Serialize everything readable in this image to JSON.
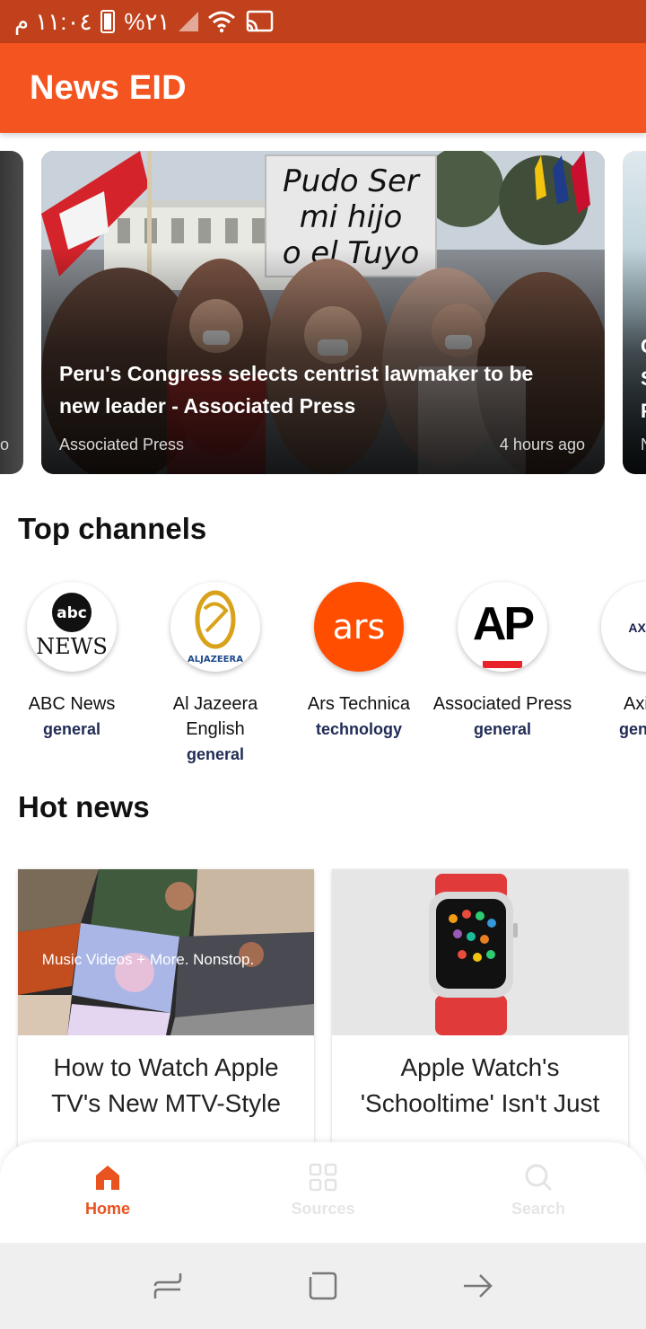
{
  "status_bar": {
    "time": "١١:٠٤ م",
    "battery": "%٢١",
    "color": "#c0411b"
  },
  "app_bar": {
    "title": "News EID",
    "color": "#f4541f"
  },
  "carousel": {
    "main": {
      "title": "Peru's Congress selects centrist lawmaker to be new leader - Associated Press",
      "source": "Associated Press",
      "time": "4 hours ago",
      "sign_text": "Pudo Ser mi hijo o el Tuyo"
    },
    "next_partial": {
      "lines": [
        "C",
        "S",
        "F"
      ],
      "source_partial": "N"
    },
    "prev_partial": {
      "source_partial": "o"
    }
  },
  "top_channels": {
    "title": "Top channels",
    "items": [
      {
        "name": "ABC News",
        "category": "general",
        "logo": "abc-news-logo"
      },
      {
        "name": "Al Jazeera English",
        "category": "general",
        "logo": "aljazeera-logo",
        "logo_text": "ALJAZEERA"
      },
      {
        "name": "Ars Technica",
        "category": "technology",
        "logo": "ars-logo",
        "logo_text": "ars"
      },
      {
        "name": "Associated Press",
        "category": "general",
        "logo": "ap-logo",
        "logo_text": "AP"
      },
      {
        "name": "Axi",
        "category": "gen",
        "logo": "axios-logo",
        "logo_text": "AXI"
      }
    ]
  },
  "hot_news": {
    "title": "Hot news",
    "items": [
      {
        "title": "How to Watch Apple TV's New MTV-Style",
        "overlay": "Music Videos + More. Nonstop."
      },
      {
        "title": "Apple Watch's 'Schooltime' Isn't Just"
      }
    ]
  },
  "bottom_nav": {
    "items": [
      {
        "label": "Home",
        "icon": "home-icon",
        "active": true
      },
      {
        "label": "Sources",
        "icon": "grid-icon",
        "active": false
      },
      {
        "label": "Search",
        "icon": "search-icon",
        "active": false
      }
    ],
    "active_color": "#e8531f"
  }
}
